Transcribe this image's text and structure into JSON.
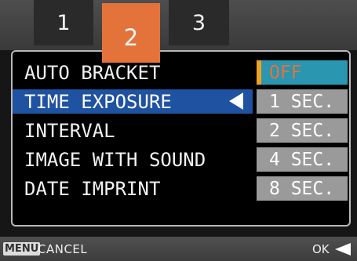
{
  "tabs": [
    {
      "label": "1",
      "active": false
    },
    {
      "label": "2",
      "active": true
    },
    {
      "label": "3",
      "active": false
    }
  ],
  "menu": {
    "items": [
      {
        "label": "AUTO BRACKET",
        "selected": false
      },
      {
        "label": "TIME EXPOSURE",
        "selected": true
      },
      {
        "label": "INTERVAL",
        "selected": false
      },
      {
        "label": "IMAGE WITH SOUND",
        "selected": false
      },
      {
        "label": "DATE IMPRINT",
        "selected": false
      }
    ],
    "selected_arrow_icon": "left-triangle-icon"
  },
  "options": {
    "items": [
      "OFF",
      "1 SEC.",
      "2 SEC.",
      "4 SEC.",
      "8 SEC."
    ],
    "current": "OFF"
  },
  "footer": {
    "menu_key": "MENU",
    "cancel_label": "CANCEL",
    "ok_label": "OK",
    "ok_icon": "left-triangle-icon"
  },
  "colors": {
    "active_tab": "#e4733b",
    "selected_row": "#1f52a0",
    "current_option_bg": "#2a96b0",
    "current_option_text": "#e4733b",
    "option_bg": "#9a9a9a"
  }
}
